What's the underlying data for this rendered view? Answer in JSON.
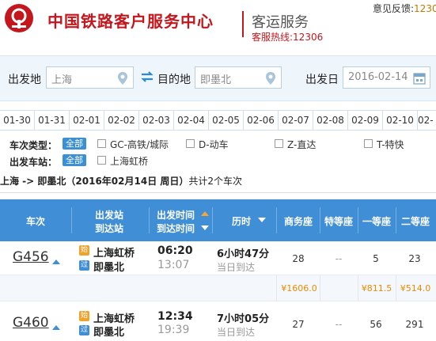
{
  "header": {
    "brand": "中国铁路客户服务中心",
    "service": "客运服务",
    "hotline": "客服热线:12306",
    "feedback_label": "意见反馈:",
    "feedback_value": "1230",
    "logo_color": "#c4161c"
  },
  "search": {
    "from_label": "出发地",
    "from_value": "上海",
    "to_label": "目的地",
    "to_value": "即墨北",
    "date_label": "出发日",
    "date_value": "2016-02-14"
  },
  "date_tabs": [
    "01-30",
    "01-31",
    "02-01",
    "02-02",
    "02-03",
    "02-04",
    "02-05",
    "02-06",
    "02-07",
    "02-08",
    "02-09",
    "02-10",
    "02-"
  ],
  "filters": {
    "type_label": "车次类型：",
    "all_label": "全部",
    "types": [
      "GC-高铁/城际",
      "D-动车",
      "Z-直达",
      "T-特快"
    ],
    "station_label": "出发车站：",
    "station_all": "全部",
    "stations": [
      "上海虹桥"
    ]
  },
  "route": {
    "text": "上海 -> 即墨北",
    "date": "（2016年02月14日  周日）",
    "count": "共计2个车次"
  },
  "table": {
    "headers": {
      "train": "车次",
      "station_top": "出发站",
      "station_bot": "到达站",
      "time_top": "出发时间",
      "time_bot": "到达时间",
      "duration": "历时",
      "business": "商务座",
      "special": "特等座",
      "first": "一等座",
      "second": "二等座"
    },
    "rows": [
      {
        "train": "G456",
        "start_badge": "始",
        "start_station": "上海虹桥",
        "end_badge": "过",
        "end_station": "即墨北",
        "depart": "06:20",
        "arrive": "13:07",
        "duration": "6小时47分",
        "duration_note": "当日到达",
        "business": "28",
        "special": "--",
        "first": "5",
        "second": "23",
        "price_business": "¥1606.0",
        "price_first": "¥811.5",
        "price_second": "¥514.0"
      },
      {
        "train": "G460",
        "start_badge": "始",
        "start_station": "上海虹桥",
        "end_badge": "过",
        "end_station": "即墨北",
        "depart": "12:34",
        "arrive": "19:39",
        "duration": "7小时05分",
        "duration_note": "当日到达",
        "business": "27",
        "special": "--",
        "first": "56",
        "second": "291"
      }
    ]
  },
  "colors": {
    "accent": "#3f8ed6",
    "brand_red": "#c4161c",
    "price": "#e98b00"
  }
}
